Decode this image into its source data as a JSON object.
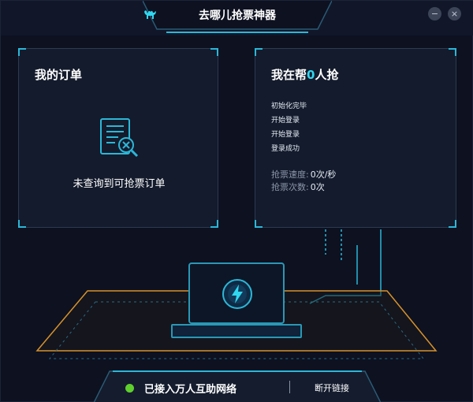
{
  "app": {
    "title": "去哪儿抢票神器"
  },
  "window_controls": {
    "minimize": "−",
    "close": "×"
  },
  "orders_panel": {
    "title": "我的订单",
    "empty_message": "未查询到可抢票订单"
  },
  "helper_panel": {
    "title_prefix": "我在帮",
    "count": "0",
    "title_suffix": "人抢",
    "log": [
      "初始化完毕",
      "开始登录",
      "开始登录",
      "登录成功"
    ],
    "stats": [
      {
        "label": "抢票速度",
        "value": "0次/秒"
      },
      {
        "label": "抢票次数",
        "value": "0次"
      }
    ]
  },
  "status": {
    "text": "已接入万人互助网络",
    "indicator_color": "#5fcf2e",
    "disconnect_label": "断开链接"
  },
  "icons": [
    "camel-logo-icon",
    "document-cancel-icon",
    "lightning-icon"
  ],
  "colors": {
    "accent": "#2bb7d8",
    "floor": "#d8922a",
    "background": "#0d1120"
  }
}
